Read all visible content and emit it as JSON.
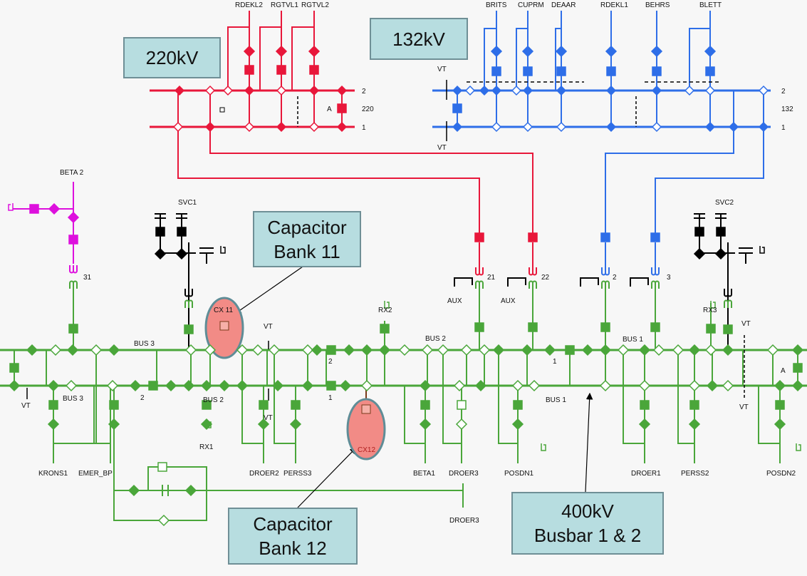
{
  "callouts": {
    "kv220": "220kV",
    "kv132": "132kV",
    "cap11_line1": "Capacitor",
    "cap11_line2": "Bank 11",
    "cap12_line1": "Capacitor",
    "cap12_line2": "Bank 12",
    "busbar_line1": "400kV",
    "busbar_line2": "Busbar 1 & 2"
  },
  "kv220": {
    "feeders": [
      "RDEKL2",
      "RGTVL1",
      "RGTVL2"
    ],
    "bus_top": "2",
    "bus_bottom": "1",
    "voltage": "220",
    "coupler": "A"
  },
  "kv132": {
    "feeders": [
      "BRITS",
      "CUPRM",
      "DEAAR",
      "RDEKL1",
      "BEHRS",
      "BLETT"
    ],
    "bus_top": "2",
    "bus_bottom": "1",
    "voltage": "132",
    "vt": "VT"
  },
  "transformers": {
    "beta2": "BETA 2",
    "t31": "31",
    "t21": "21",
    "t22": "22",
    "t2": "2",
    "t3": "3",
    "aux": "AUX"
  },
  "svc": {
    "svc1": "SVC1",
    "svc2": "SVC2"
  },
  "capacitors": {
    "cx11": "CX 11",
    "cx12": "CX12"
  },
  "reactors": {
    "rx1": "RX1",
    "rx2": "RX2",
    "rx3": "RX3"
  },
  "bus400": {
    "bus3": "BUS 3",
    "bus2": "BUS 2",
    "bus1": "BUS 1",
    "vt": "VT",
    "sec2": "2",
    "sec1": "1",
    "coupler": "A"
  },
  "feeders400": [
    "KRONS1",
    "EMER_BP",
    "DROER2",
    "PERSS3",
    "BETA1",
    "DROER3",
    "POSDN1",
    "DROER1",
    "PERSS2",
    "POSDN2"
  ],
  "droer3_bypass": "DROER3",
  "colors": {
    "red": "#e8173a",
    "blue": "#2e6ee8",
    "green": "#4aa63a",
    "magenta": "#dd10dd",
    "callout_bg": "#b7dde0",
    "capacitor_highlight": "#f28b86"
  }
}
